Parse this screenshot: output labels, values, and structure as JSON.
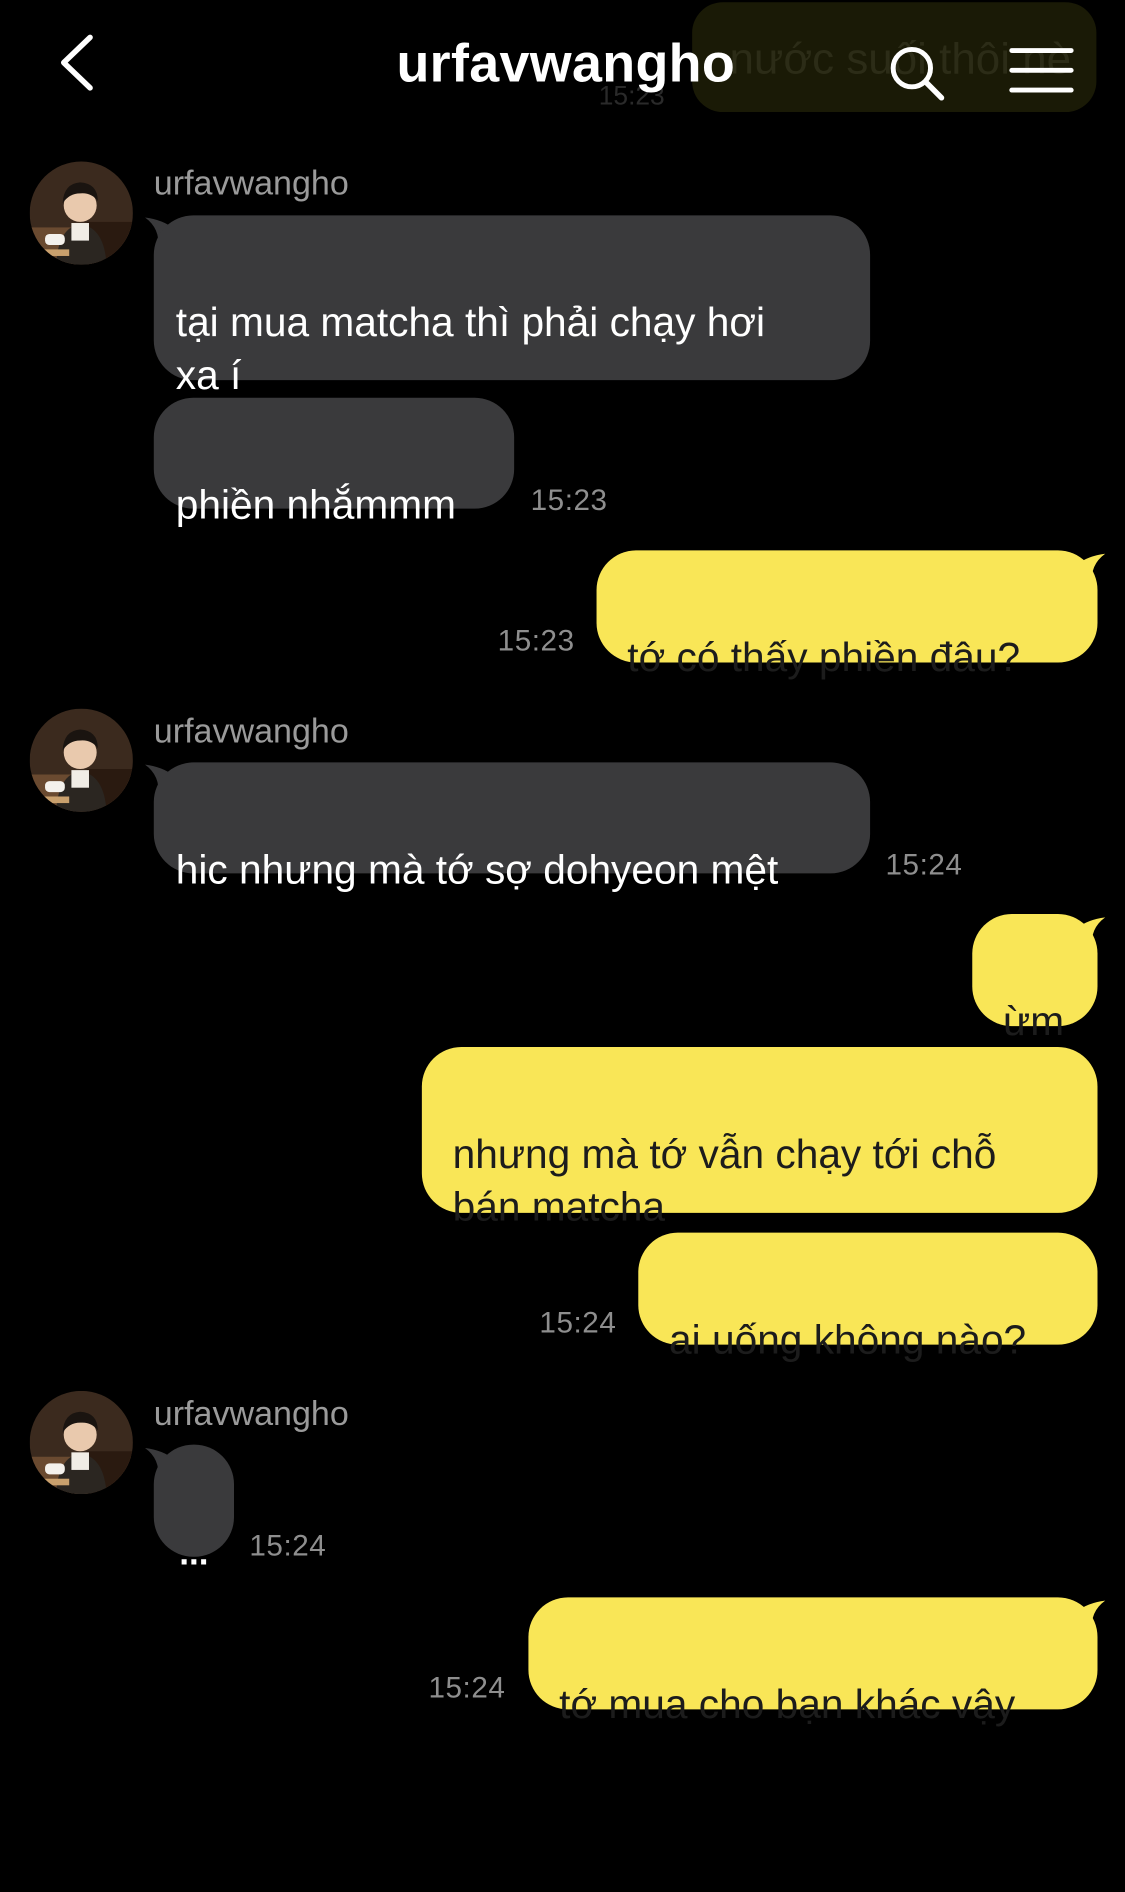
{
  "header": {
    "title": "urfavwangho",
    "ghost_text": "nước suối thôi nè",
    "ghost_time": "15:23"
  },
  "icons": {
    "back": "chevron-left-icon",
    "search": "search-icon",
    "menu": "menu-icon"
  },
  "colors": {
    "background": "#000000",
    "incoming_bubble": "#3a3a3c",
    "outgoing_bubble": "#f9e657",
    "timestamp": "#8e8e8e"
  },
  "messages": [
    {
      "sender": "urfavwangho",
      "text": "tại mua matcha thì phải chạy hơi\nxa í"
    },
    {
      "text": "phiền nhắmmm",
      "time": "15:23"
    },
    {
      "text": "tớ có thấy phiền đâu?",
      "time": "15:23"
    },
    {
      "sender": "urfavwangho",
      "text": "hic nhưng mà tớ sợ dohyeon mệt",
      "time": "15:24"
    },
    {
      "text": "ừm"
    },
    {
      "text": "nhưng mà tớ vẫn chạy tới chỗ\nbán matcha"
    },
    {
      "text": "ai uống không nào?",
      "time": "15:24"
    },
    {
      "sender": "urfavwangho",
      "text": "...",
      "time": "15:24"
    },
    {
      "text": "tớ mua cho bạn khác vậy",
      "time": "15:24"
    }
  ]
}
